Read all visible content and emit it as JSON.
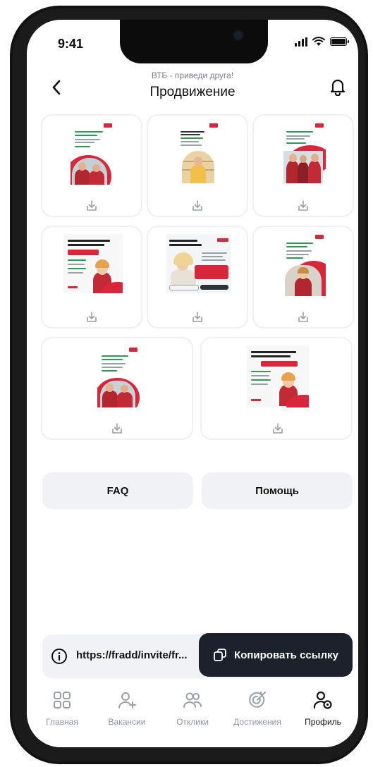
{
  "status_bar": {
    "time": "9:41"
  },
  "header": {
    "subtitle": "ВТБ - приведи друга!",
    "title": "Продвижение"
  },
  "promo_materials": {
    "items": [
      {
        "caption": "Download promo material 1"
      },
      {
        "caption": "Download promo material 2"
      },
      {
        "caption": "Download promo material 3"
      },
      {
        "caption": "Download promo material 4"
      },
      {
        "caption": "Download promo material 5"
      },
      {
        "caption": "Download promo material 6"
      },
      {
        "caption": "Download promo material 7"
      },
      {
        "caption": "Download promo material 8"
      }
    ]
  },
  "buttons": {
    "faq": "FAQ",
    "help": "Помощь"
  },
  "invite": {
    "link": "https://fradd/invite/fr...",
    "copy_label": "Копировать ссылку"
  },
  "tabs": [
    {
      "label": "Главная",
      "icon": "grid-icon",
      "active": false
    },
    {
      "label": "Вакансии",
      "icon": "user-plus-icon",
      "active": false
    },
    {
      "label": "Отклики",
      "icon": "users-icon",
      "active": false
    },
    {
      "label": "Достижения",
      "icon": "target-icon",
      "active": false
    },
    {
      "label": "Профиль",
      "icon": "user-settings-icon",
      "active": true
    }
  ],
  "colors": {
    "accent_dark": "#1c212b",
    "brand_red": "#d8263a",
    "surface": "#f1f2f5"
  }
}
